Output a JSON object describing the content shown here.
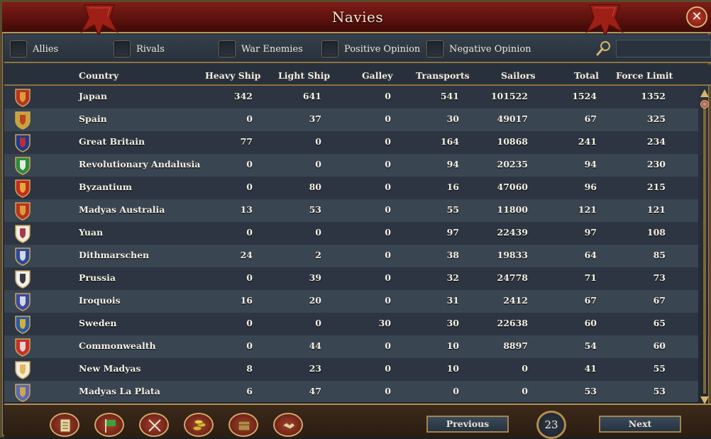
{
  "window": {
    "title": "Navies",
    "close_symbol": "✕"
  },
  "filters": [
    {
      "label": "Allies",
      "checked": false
    },
    {
      "label": "Rivals",
      "checked": false
    },
    {
      "label": "War Enemies",
      "checked": false
    },
    {
      "label": "Positive Opinion",
      "checked": false
    },
    {
      "label": "Negative Opinion",
      "checked": false
    }
  ],
  "search": {
    "value": "",
    "icon": "magnifier-icon"
  },
  "columns": [
    "Country",
    "Heavy Ship",
    "Light Ship",
    "Galley",
    "Transports",
    "Sailors",
    "Total",
    "Force Limit"
  ],
  "rows": [
    {
      "country": "Japan",
      "heavy": "342",
      "light": "641",
      "galley": "0",
      "transports": "541",
      "sailors": "101522",
      "total": "1524",
      "force_limit": "1352",
      "flag_colors": [
        "#b8331f",
        "#e0b040"
      ]
    },
    {
      "country": "Spain",
      "heavy": "0",
      "light": "37",
      "galley": "0",
      "transports": "30",
      "sailors": "49017",
      "total": "67",
      "force_limit": "325",
      "flag_colors": [
        "#c8a43a",
        "#b8331f"
      ]
    },
    {
      "country": "Great Britain",
      "heavy": "77",
      "light": "0",
      "galley": "0",
      "transports": "164",
      "sailors": "10868",
      "total": "241",
      "force_limit": "234",
      "flag_colors": [
        "#1f3a8a",
        "#d22b2b"
      ]
    },
    {
      "country": "Revolutionary Andalusia",
      "heavy": "0",
      "light": "0",
      "galley": "0",
      "transports": "94",
      "sailors": "20235",
      "total": "94",
      "force_limit": "230",
      "flag_colors": [
        "#2e8b3a",
        "#ffffff"
      ]
    },
    {
      "country": "Byzantium",
      "heavy": "0",
      "light": "80",
      "galley": "0",
      "transports": "16",
      "sailors": "47060",
      "total": "96",
      "force_limit": "215",
      "flag_colors": [
        "#c52b1e",
        "#e8c040"
      ]
    },
    {
      "country": "Madyas Australia",
      "heavy": "13",
      "light": "53",
      "galley": "0",
      "transports": "55",
      "sailors": "11800",
      "total": "121",
      "force_limit": "121",
      "flag_colors": [
        "#b8331f",
        "#e0b040"
      ]
    },
    {
      "country": "Yuan",
      "heavy": "0",
      "light": "0",
      "galley": "0",
      "transports": "97",
      "sailors": "22439",
      "total": "97",
      "force_limit": "108",
      "flag_colors": [
        "#f0ece0",
        "#9b1b30"
      ]
    },
    {
      "country": "Dithmarschen",
      "heavy": "24",
      "light": "2",
      "galley": "0",
      "transports": "38",
      "sailors": "19833",
      "total": "64",
      "force_limit": "85",
      "flag_colors": [
        "#2a4a9a",
        "#f0f0f0"
      ]
    },
    {
      "country": "Prussia",
      "heavy": "0",
      "light": "39",
      "galley": "0",
      "transports": "32",
      "sailors": "24778",
      "total": "71",
      "force_limit": "73",
      "flag_colors": [
        "#f0f0f0",
        "#1a1a1a"
      ]
    },
    {
      "country": "Iroquois",
      "heavy": "16",
      "light": "20",
      "galley": "0",
      "transports": "31",
      "sailors": "2412",
      "total": "67",
      "force_limit": "67",
      "flag_colors": [
        "#3a4aa0",
        "#f0f0f0"
      ]
    },
    {
      "country": "Sweden",
      "heavy": "0",
      "light": "0",
      "galley": "30",
      "transports": "30",
      "sailors": "22638",
      "total": "60",
      "force_limit": "65",
      "flag_colors": [
        "#2a5aa8",
        "#f0c020"
      ]
    },
    {
      "country": "Commonwealth",
      "heavy": "0",
      "light": "44",
      "galley": "0",
      "transports": "10",
      "sailors": "8897",
      "total": "54",
      "force_limit": "60",
      "flag_colors": [
        "#c8302a",
        "#f0f0f0"
      ]
    },
    {
      "country": "New Madyas",
      "heavy": "8",
      "light": "23",
      "galley": "0",
      "transports": "10",
      "sailors": "0",
      "total": "41",
      "force_limit": "55",
      "flag_colors": [
        "#f0ece0",
        "#e0b040"
      ]
    },
    {
      "country": "Madyas La Plata",
      "heavy": "6",
      "light": "47",
      "galley": "0",
      "transports": "0",
      "sailors": "0",
      "total": "53",
      "force_limit": "53",
      "flag_colors": [
        "#5a6ab0",
        "#e0b040"
      ]
    }
  ],
  "bottom_nav": [
    {
      "icon": "ledger-icon"
    },
    {
      "icon": "flag-icon"
    },
    {
      "icon": "crossed-swords-icon"
    },
    {
      "icon": "coins-icon"
    },
    {
      "icon": "crate-icon"
    },
    {
      "icon": "handshake-icon"
    }
  ],
  "pagination": {
    "previous": "Previous",
    "next": "Next",
    "page": "23"
  },
  "colors": {
    "title_red": "#7e1d17",
    "gold_trim": "#b99356",
    "row_light": "#3a4552",
    "row_dark": "#2c3541"
  }
}
